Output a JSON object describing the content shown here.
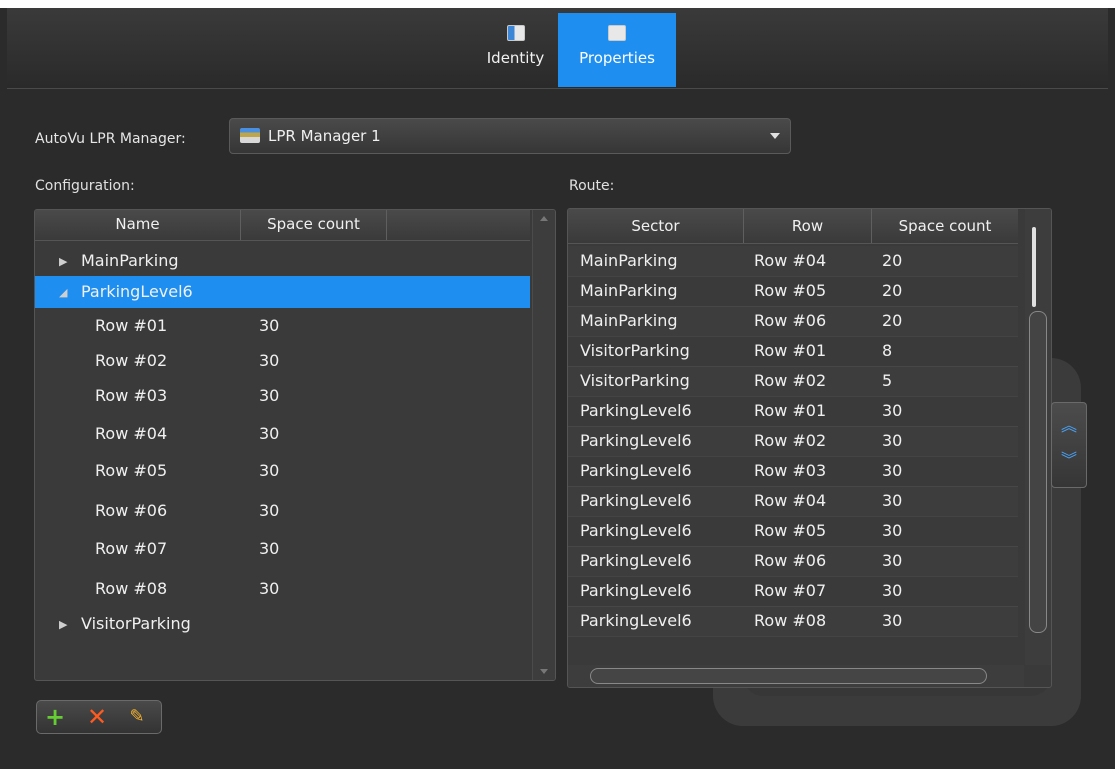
{
  "tabs": [
    {
      "label": "Identity",
      "icon": "identity-icon"
    },
    {
      "label": "Properties",
      "icon": "properties-icon"
    }
  ],
  "manager": {
    "label": "AutoVu LPR Manager:",
    "selected": "LPR Manager 1"
  },
  "configuration": {
    "label": "Configuration:",
    "columns": [
      "Name",
      "Space count"
    ],
    "nodes": [
      {
        "name": "MainParking",
        "count": "",
        "level": 0,
        "expanded": false
      },
      {
        "name": "ParkingLevel6",
        "count": "",
        "level": 0,
        "expanded": true,
        "selected": true
      },
      {
        "name": "Row #01",
        "count": "30",
        "level": 1
      },
      {
        "name": "Row #02",
        "count": "30",
        "level": 1
      },
      {
        "name": "Row #03",
        "count": "30",
        "level": 1
      },
      {
        "name": "Row #04",
        "count": "30",
        "level": 1
      },
      {
        "name": "Row #05",
        "count": "30",
        "level": 1
      },
      {
        "name": "Row #06",
        "count": "30",
        "level": 1
      },
      {
        "name": "Row #07",
        "count": "30",
        "level": 1
      },
      {
        "name": "Row #08",
        "count": "30",
        "level": 1
      },
      {
        "name": "VisitorParking",
        "count": "",
        "level": 0,
        "expanded": false
      }
    ]
  },
  "route": {
    "label": "Route:",
    "columns": [
      "Sector",
      "Row",
      "Space count"
    ],
    "rows": [
      [
        "MainParking",
        "Row #04",
        "20"
      ],
      [
        "MainParking",
        "Row #05",
        "20"
      ],
      [
        "MainParking",
        "Row #06",
        "20"
      ],
      [
        "VisitorParking",
        "Row #01",
        "8"
      ],
      [
        "VisitorParking",
        "Row #02",
        "5"
      ],
      [
        "ParkingLevel6",
        "Row #01",
        "30"
      ],
      [
        "ParkingLevel6",
        "Row #02",
        "30"
      ],
      [
        "ParkingLevel6",
        "Row #03",
        "30"
      ],
      [
        "ParkingLevel6",
        "Row #04",
        "30"
      ],
      [
        "ParkingLevel6",
        "Row #05",
        "30"
      ],
      [
        "ParkingLevel6",
        "Row #06",
        "30"
      ],
      [
        "ParkingLevel6",
        "Row #07",
        "30"
      ],
      [
        "ParkingLevel6",
        "Row #08",
        "30"
      ]
    ]
  },
  "actions": {
    "add": "+",
    "delete": "✕",
    "edit": "✎"
  },
  "colors": {
    "accent": "#1e8ff0",
    "background": "#2b2b2b"
  }
}
